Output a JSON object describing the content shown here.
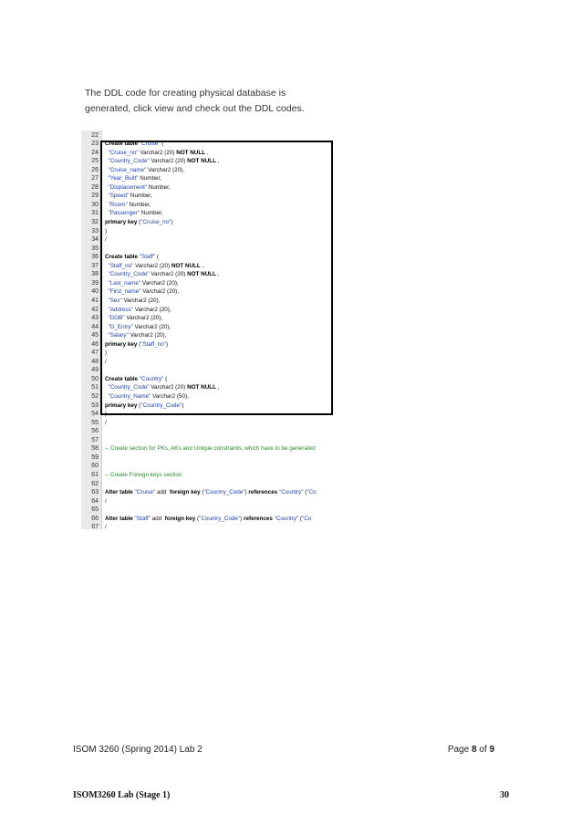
{
  "intro": {
    "line1": "The DDL code for creating physical database is",
    "line2": "generated,  click view and check out the DDL codes."
  },
  "code_lines": [
    {
      "n": "22",
      "html": ""
    },
    {
      "n": "23",
      "html": "<span class='kw'>Create table</span> <span class='id'>\"Cruise\"</span> ("
    },
    {
      "n": "24",
      "html": "&nbsp;&nbsp;<span class='id'>\"Cruise_no\"</span> Varchar2 (20) <span class='kw'>NOT NULL</span> ,"
    },
    {
      "n": "25",
      "html": "&nbsp;&nbsp;<span class='id'>\"Country_Code\"</span> Varchar2 (20) <span class='kw'>NOT NULL</span> ,"
    },
    {
      "n": "26",
      "html": "&nbsp;&nbsp;<span class='id'>\"Cruise_name\"</span> Varchar2 (20),"
    },
    {
      "n": "27",
      "html": "&nbsp;&nbsp;<span class='id'>\"Year_Built\"</span> Number,"
    },
    {
      "n": "28",
      "html": "&nbsp;&nbsp;<span class='id'>\"Displacement\"</span> Number,"
    },
    {
      "n": "29",
      "html": "&nbsp;&nbsp;<span class='id'>\"Speed\"</span> Number,"
    },
    {
      "n": "30",
      "html": "&nbsp;&nbsp;<span class='id'>\"Room\"</span> Number,"
    },
    {
      "n": "31",
      "html": "&nbsp;&nbsp;<span class='id'>\"Passenger\"</span> Number,"
    },
    {
      "n": "32",
      "html": "<span class='kw'>primary key</span> (<span class='id'>\"Cruise_no\"</span>)"
    },
    {
      "n": "33",
      "html": ")"
    },
    {
      "n": "34",
      "html": "/"
    },
    {
      "n": "35",
      "html": ""
    },
    {
      "n": "36",
      "html": "<span class='kw'>Create table</span> <span class='id'>\"Staff\"</span> ("
    },
    {
      "n": "37",
      "html": "&nbsp;&nbsp;<span class='id'>\"Staff_no\"</span> Varchar2 (20) <span class='kw'>NOT NULL</span> ,"
    },
    {
      "n": "38",
      "html": "&nbsp;&nbsp;<span class='id'>\"Country_Code\"</span> Varchar2 (20) <span class='kw'>NOT NULL</span> ,"
    },
    {
      "n": "39",
      "html": "&nbsp;&nbsp;<span class='id'>\"Last_name\"</span> Varchar2 (20),"
    },
    {
      "n": "40",
      "html": "&nbsp;&nbsp;<span class='id'>\"First_name\"</span> Varchar2 (20),"
    },
    {
      "n": "41",
      "html": "&nbsp;&nbsp;<span class='id'>\"Sex\"</span> Varchar2 (20),"
    },
    {
      "n": "42",
      "html": "&nbsp;&nbsp;<span class='id'>\"Address\"</span> Varchar2 (20),"
    },
    {
      "n": "43",
      "html": "&nbsp;&nbsp;<span class='id'>\"DOB\"</span> Varchar2 (20),"
    },
    {
      "n": "44",
      "html": "&nbsp;&nbsp;<span class='id'>\"D_Entry\"</span> Varchar2 (20),"
    },
    {
      "n": "45",
      "html": "&nbsp;&nbsp;<span class='id'>\"Salary\"</span> Varchar2 (20),"
    },
    {
      "n": "46",
      "html": "<span class='kw'>primary key</span> (<span class='id'>\"Staff_no\"</span>)"
    },
    {
      "n": "47",
      "html": ")"
    },
    {
      "n": "48",
      "html": "/"
    },
    {
      "n": "49",
      "html": ""
    },
    {
      "n": "50",
      "html": "<span class='kw'>Create table</span> <span class='id'>\"Country\"</span> ("
    },
    {
      "n": "51",
      "html": "&nbsp;&nbsp;<span class='id'>\"Country_Code\"</span> Varchar2 (20) <span class='kw'>NOT NULL</span> ,"
    },
    {
      "n": "52",
      "html": "&nbsp;&nbsp;<span class='id'>\"Country_Name\"</span> Varchar2 (50),"
    },
    {
      "n": "53",
      "html": "<span class='kw'>primary key</span> (<span class='id'>\"Country_Code\"</span>)"
    },
    {
      "n": "54",
      "html": ")"
    },
    {
      "n": "55",
      "html": "/"
    },
    {
      "n": "56",
      "html": ""
    },
    {
      "n": "57",
      "html": ""
    },
    {
      "n": "58",
      "html": "<span class='cm'>-- Create section for PKs, AKs and Unique constraints, which have to be generated</span>"
    },
    {
      "n": "59",
      "html": ""
    },
    {
      "n": "60",
      "html": ""
    },
    {
      "n": "61",
      "html": "<span class='cm'>-- Create Foreign keys section</span>"
    },
    {
      "n": "62",
      "html": ""
    },
    {
      "n": "63",
      "html": "<span class='kw'>Alter table</span> <span class='id'>\"Cruise\"</span> add &nbsp;<span class='kw'>foreign key</span> (<span class='id'>\"Country_Code\"</span>) <span class='kw'>references</span> <span class='id'>\"Country\"</span> (<span class='id'>\"Co</span>"
    },
    {
      "n": "64",
      "html": "/"
    },
    {
      "n": "65",
      "html": ""
    },
    {
      "n": "66",
      "html": "<span class='kw'>Alter table</span> <span class='id'>\"Staff\"</span> add &nbsp;<span class='kw'>foreign key</span> (<span class='id'>\"Country_Code\"</span>) <span class='kw'>references</span> <span class='id'>\"Country\"</span> (<span class='id'>\"Co</span>"
    },
    {
      "n": "67",
      "html": "/"
    }
  ],
  "footer": {
    "left": "ISOM 3260 (Spring 2014) Lab 2",
    "page_prefix": "Page ",
    "page_current": "8",
    "page_of": " of ",
    "page_total": "9"
  },
  "bottom": {
    "left": "ISOM3260 Lab (Stage 1)",
    "right": "30"
  }
}
